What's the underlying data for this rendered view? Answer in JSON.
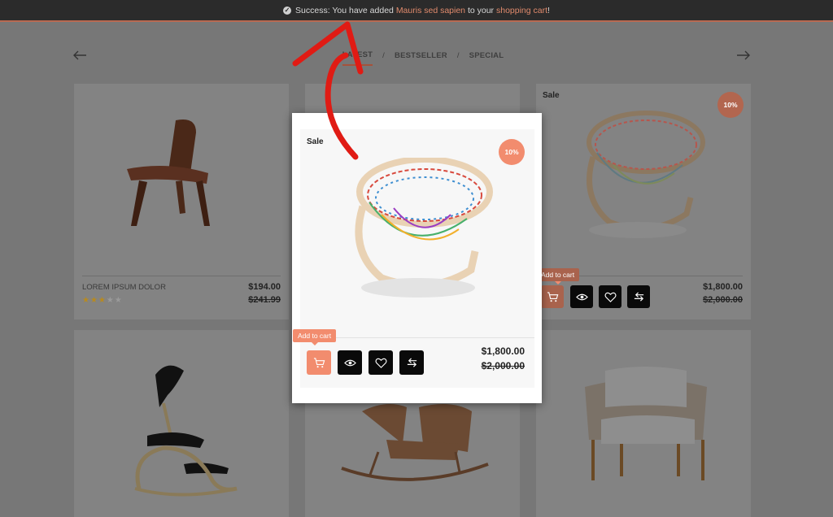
{
  "notification": {
    "prefix": "Success: You have added ",
    "product_link": "Mauris sed sapien",
    "middle": " to your ",
    "cart_link": "shopping cart",
    "suffix": "!"
  },
  "tabs": [
    {
      "label": "LATEST",
      "active": true
    },
    {
      "label": "BESTSELLER",
      "active": false
    },
    {
      "label": "SPECIAL",
      "active": false
    }
  ],
  "tab_separator": "/",
  "products": [
    {
      "name": "LOREM IPSUM DOLOR",
      "price": "$194.00",
      "old_price": "$241.99",
      "rating": 3,
      "rating_max": 5
    },
    {
      "sale_label": "Sale",
      "discount": "10%",
      "price": "$1,800.00",
      "old_price": "$2,000.00"
    }
  ],
  "modal": {
    "sale_label": "Sale",
    "discount": "10%",
    "tooltip": "Add to cart",
    "price": "$1,800.00",
    "old_price": "$2,000.00",
    "icons": [
      "cart-icon",
      "eye-icon",
      "heart-icon",
      "compare-icon"
    ]
  },
  "right_card_tooltip": "Add to cart",
  "colors": {
    "accent": "#f28c6e",
    "overlay": "#777777",
    "bar": "#2b2b2b",
    "link": "#e08a6c"
  }
}
